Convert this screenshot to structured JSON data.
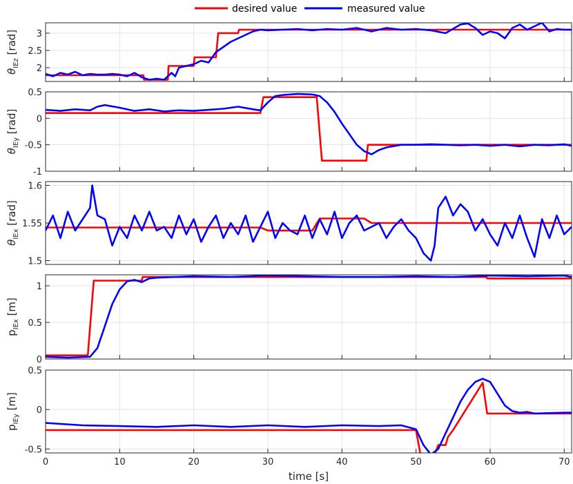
{
  "legend": {
    "desired_label": "desired value",
    "measured_label": "measured value"
  },
  "colors": {
    "desired": "#ff0000",
    "measured": "#0000ff",
    "grid": "#e3e3e3",
    "axis": "#262626"
  },
  "xlabel": "time [s]",
  "chart_data": [
    {
      "type": "line",
      "ylabel_main": "θ",
      "ylabel_sub": "IEz",
      "ylabel_unit": "[rad]",
      "xlim": [
        0,
        71
      ],
      "ylim": [
        1.6,
        3.3
      ],
      "yticks": [
        2,
        2.5,
        3
      ],
      "ytick_labels": [
        "2",
        "2.5",
        "3"
      ],
      "xticks": [
        0,
        10,
        20,
        30,
        40,
        50,
        60,
        70
      ],
      "grid": true,
      "series": [
        {
          "name": "desired value",
          "color": "#ff0000",
          "x": [
            0,
            13.2,
            13.3,
            16.5,
            16.6,
            20,
            20.1,
            23,
            23.3,
            26,
            26.1,
            71
          ],
          "y": [
            1.78,
            1.78,
            1.65,
            1.65,
            2.05,
            2.05,
            2.3,
            2.3,
            3.0,
            3.0,
            3.1,
            3.1
          ]
        },
        {
          "name": "measured value",
          "color": "#0000ff",
          "x": [
            0,
            1,
            2,
            3,
            4,
            5,
            6,
            7,
            8,
            9,
            10,
            11,
            12,
            13,
            14,
            15,
            16,
            17,
            17.5,
            18,
            19,
            20,
            21,
            22,
            23,
            24,
            25,
            26,
            27,
            28,
            29,
            30,
            32,
            34,
            36,
            38,
            40,
            42,
            44,
            46,
            48,
            50,
            52,
            54,
            56,
            57,
            58,
            59,
            60,
            61,
            62,
            63,
            64,
            65,
            66,
            67,
            68,
            69,
            70,
            71
          ],
          "y": [
            1.82,
            1.75,
            1.85,
            1.8,
            1.88,
            1.78,
            1.82,
            1.8,
            1.8,
            1.82,
            1.8,
            1.75,
            1.85,
            1.72,
            1.65,
            1.68,
            1.65,
            1.85,
            1.75,
            2.0,
            2.05,
            2.1,
            2.2,
            2.15,
            2.45,
            2.6,
            2.75,
            2.85,
            2.95,
            3.05,
            3.1,
            3.08,
            3.1,
            3.12,
            3.08,
            3.12,
            3.1,
            3.15,
            3.05,
            3.15,
            3.1,
            3.12,
            3.08,
            3.0,
            3.25,
            3.28,
            3.15,
            2.95,
            3.05,
            3.0,
            2.85,
            3.15,
            3.25,
            3.1,
            3.2,
            3.3,
            3.05,
            3.12,
            3.1,
            3.1
          ]
        }
      ]
    },
    {
      "type": "line",
      "ylabel_main": "θ",
      "ylabel_sub": "IEy",
      "ylabel_unit": "[rad]",
      "xlim": [
        0,
        71
      ],
      "ylim": [
        -1,
        0.5
      ],
      "yticks": [
        -1,
        -0.5,
        0,
        0.5
      ],
      "ytick_labels": [
        "-1",
        "-0.5",
        "0",
        "0.5"
      ],
      "xticks": [
        0,
        10,
        20,
        30,
        40,
        50,
        60,
        70
      ],
      "grid": true,
      "series": [
        {
          "name": "desired value",
          "color": "#ff0000",
          "x": [
            0,
            29,
            29.4,
            36.6,
            37.3,
            43.3,
            43.5,
            71
          ],
          "y": [
            0.1,
            0.1,
            0.4,
            0.4,
            -0.8,
            -0.8,
            -0.5,
            -0.5
          ]
        },
        {
          "name": "measured value",
          "color": "#0000ff",
          "x": [
            0,
            2,
            4,
            6,
            7,
            8,
            10,
            12,
            14,
            16,
            18,
            20,
            22,
            24,
            26,
            28,
            29,
            30,
            31,
            32,
            34,
            36,
            37,
            38,
            39,
            40,
            41,
            42,
            43,
            44,
            45,
            46,
            48,
            50,
            52,
            54,
            56,
            58,
            60,
            62,
            64,
            66,
            68,
            70,
            71
          ],
          "y": [
            0.16,
            0.14,
            0.17,
            0.15,
            0.22,
            0.25,
            0.2,
            0.14,
            0.17,
            0.13,
            0.15,
            0.14,
            0.16,
            0.18,
            0.22,
            0.17,
            0.15,
            0.3,
            0.42,
            0.44,
            0.46,
            0.45,
            0.42,
            0.3,
            0.12,
            -0.1,
            -0.3,
            -0.5,
            -0.62,
            -0.68,
            -0.6,
            -0.55,
            -0.5,
            -0.5,
            -0.49,
            -0.5,
            -0.51,
            -0.5,
            -0.52,
            -0.5,
            -0.53,
            -0.5,
            -0.51,
            -0.49,
            -0.52
          ]
        }
      ]
    },
    {
      "type": "line",
      "ylabel_main": "θ",
      "ylabel_sub": "IEx",
      "ylabel_unit": "[rad]",
      "xlim": [
        0,
        71
      ],
      "ylim": [
        1.495,
        1.605
      ],
      "yticks": [
        1.5,
        1.55,
        1.6
      ],
      "ytick_labels": [
        "1.5",
        "1.55",
        "1.6"
      ],
      "xticks": [
        0,
        10,
        20,
        30,
        40,
        50,
        60,
        70
      ],
      "grid": true,
      "series": [
        {
          "name": "desired value",
          "color": "#ff0000",
          "x": [
            0,
            29,
            30,
            36,
            37,
            43,
            44,
            71
          ],
          "y": [
            1.544,
            1.544,
            1.54,
            1.54,
            1.556,
            1.556,
            1.55,
            1.55
          ]
        },
        {
          "name": "measured value",
          "color": "#0000ff",
          "x": [
            0,
            1,
            2,
            3,
            4,
            5,
            6,
            6.3,
            7,
            8,
            9,
            10,
            11,
            12,
            13,
            14,
            15,
            16,
            17,
            18,
            19,
            20,
            21,
            22,
            23,
            24,
            25,
            26,
            27,
            28,
            29,
            30,
            31,
            32,
            33,
            34,
            35,
            36,
            37,
            38,
            39,
            40,
            41,
            42,
            43,
            44,
            45,
            46,
            47,
            48,
            49,
            50,
            51,
            52,
            52.5,
            53,
            54,
            55,
            56,
            57,
            58,
            59,
            60,
            61,
            62,
            63,
            64,
            65,
            66,
            67,
            68,
            69,
            70,
            71
          ],
          "y": [
            1.54,
            1.56,
            1.53,
            1.565,
            1.54,
            1.555,
            1.57,
            1.6,
            1.56,
            1.555,
            1.52,
            1.545,
            1.53,
            1.56,
            1.54,
            1.565,
            1.54,
            1.545,
            1.53,
            1.56,
            1.535,
            1.555,
            1.525,
            1.545,
            1.56,
            1.53,
            1.55,
            1.535,
            1.56,
            1.525,
            1.545,
            1.565,
            1.53,
            1.55,
            1.54,
            1.535,
            1.56,
            1.53,
            1.555,
            1.535,
            1.565,
            1.53,
            1.55,
            1.56,
            1.54,
            1.545,
            1.55,
            1.53,
            1.545,
            1.555,
            1.54,
            1.53,
            1.51,
            1.5,
            1.52,
            1.57,
            1.585,
            1.56,
            1.575,
            1.565,
            1.54,
            1.555,
            1.535,
            1.52,
            1.55,
            1.53,
            1.56,
            1.53,
            1.505,
            1.555,
            1.53,
            1.56,
            1.535,
            1.545
          ]
        }
      ]
    },
    {
      "type": "line",
      "ylabel_main": "p",
      "ylabel_sub": "IEx",
      "ylabel_unit": "[m]",
      "xlim": [
        0,
        71
      ],
      "ylim": [
        0,
        1.15
      ],
      "yticks": [
        0,
        0.5,
        1
      ],
      "ytick_labels": [
        "0",
        "0.5",
        "1"
      ],
      "xticks": [
        0,
        10,
        20,
        30,
        40,
        50,
        60,
        70
      ],
      "grid": true,
      "series": [
        {
          "name": "desired value",
          "color": "#ff0000",
          "x": [
            0,
            5.7,
            6.5,
            13,
            13.1,
            59.5,
            59.6,
            71
          ],
          "y": [
            0.05,
            0.05,
            1.07,
            1.07,
            1.12,
            1.12,
            1.1,
            1.1
          ]
        },
        {
          "name": "measured value",
          "color": "#0000ff",
          "x": [
            0,
            3,
            6,
            7,
            8,
            9,
            10,
            11,
            12,
            13,
            14,
            15,
            20,
            25,
            30,
            35,
            40,
            45,
            50,
            55,
            60,
            65,
            70,
            71
          ],
          "y": [
            0.03,
            0.02,
            0.03,
            0.15,
            0.45,
            0.75,
            0.95,
            1.06,
            1.08,
            1.05,
            1.1,
            1.11,
            1.13,
            1.12,
            1.14,
            1.13,
            1.12,
            1.12,
            1.13,
            1.12,
            1.14,
            1.13,
            1.14,
            1.12
          ]
        }
      ]
    },
    {
      "type": "line",
      "ylabel_main": "p",
      "ylabel_sub": "IEy",
      "ylabel_unit": "[m]",
      "xlim": [
        0,
        71
      ],
      "ylim": [
        -0.55,
        0.5
      ],
      "yticks": [
        -0.5,
        0,
        0.5
      ],
      "ytick_labels": [
        "-0.5",
        "0",
        "0.5"
      ],
      "xticks": [
        0,
        10,
        20,
        30,
        40,
        50,
        60,
        70
      ],
      "grid": true,
      "xtick_labels": [
        "0",
        "10",
        "20",
        "30",
        "40",
        "50",
        "60",
        "70"
      ],
      "series": [
        {
          "name": "desired value",
          "color": "#ff0000",
          "x": [
            0,
            50,
            50.6,
            52.5,
            53,
            54,
            54.3,
            55,
            59,
            59.6,
            71
          ],
          "y": [
            -0.26,
            -0.26,
            -0.57,
            -0.57,
            -0.45,
            -0.45,
            -0.35,
            -0.26,
            0.34,
            -0.05,
            -0.05
          ]
        },
        {
          "name": "measured value",
          "color": "#0000ff",
          "x": [
            0,
            5,
            10,
            15,
            20,
            25,
            30,
            35,
            40,
            45,
            48,
            50,
            51,
            52,
            53,
            54,
            55,
            56,
            57,
            58,
            59,
            60,
            61,
            62,
            63,
            64,
            65,
            66,
            70,
            71
          ],
          "y": [
            -0.17,
            -0.2,
            -0.21,
            -0.22,
            -0.2,
            -0.22,
            -0.2,
            -0.22,
            -0.2,
            -0.21,
            -0.2,
            -0.25,
            -0.45,
            -0.57,
            -0.5,
            -0.3,
            -0.1,
            0.1,
            0.25,
            0.35,
            0.39,
            0.35,
            0.2,
            0.05,
            -0.02,
            -0.04,
            -0.03,
            -0.05,
            -0.04,
            -0.04
          ]
        }
      ]
    }
  ]
}
